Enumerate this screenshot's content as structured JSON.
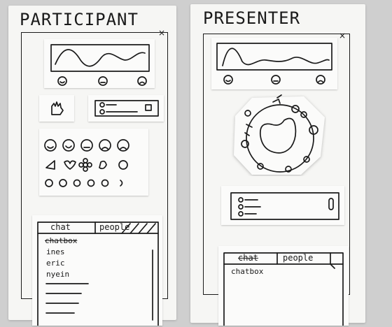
{
  "participant": {
    "title": "PARTICIPANT",
    "close_glyph": "×",
    "emotion_icons": [
      "happy-face-icon",
      "neutral-face-icon",
      "sad-face-icon"
    ],
    "reaction_rows": {
      "faces": [
        "smile-face-icon",
        "happy-face-icon",
        "neutral-face-icon",
        "sad-face-icon",
        "crying-face-icon"
      ],
      "shapes": [
        "triangle-icon",
        "heart-icon",
        "flower-icon",
        "leaf-icon",
        "bubble-icon"
      ],
      "circles": 6
    },
    "chat": {
      "tabs": [
        "chat",
        "people"
      ],
      "header": "chatbox",
      "people": [
        "ines",
        "eric",
        "nyein"
      ]
    }
  },
  "presenter": {
    "title": "PRESENTER",
    "close_glyph": "×",
    "emotion_icons": [
      "happy-face-icon",
      "neutral-face-icon",
      "sad-face-icon"
    ],
    "chat": {
      "tabs": [
        "chat",
        "people"
      ],
      "header": "chatbox"
    }
  }
}
